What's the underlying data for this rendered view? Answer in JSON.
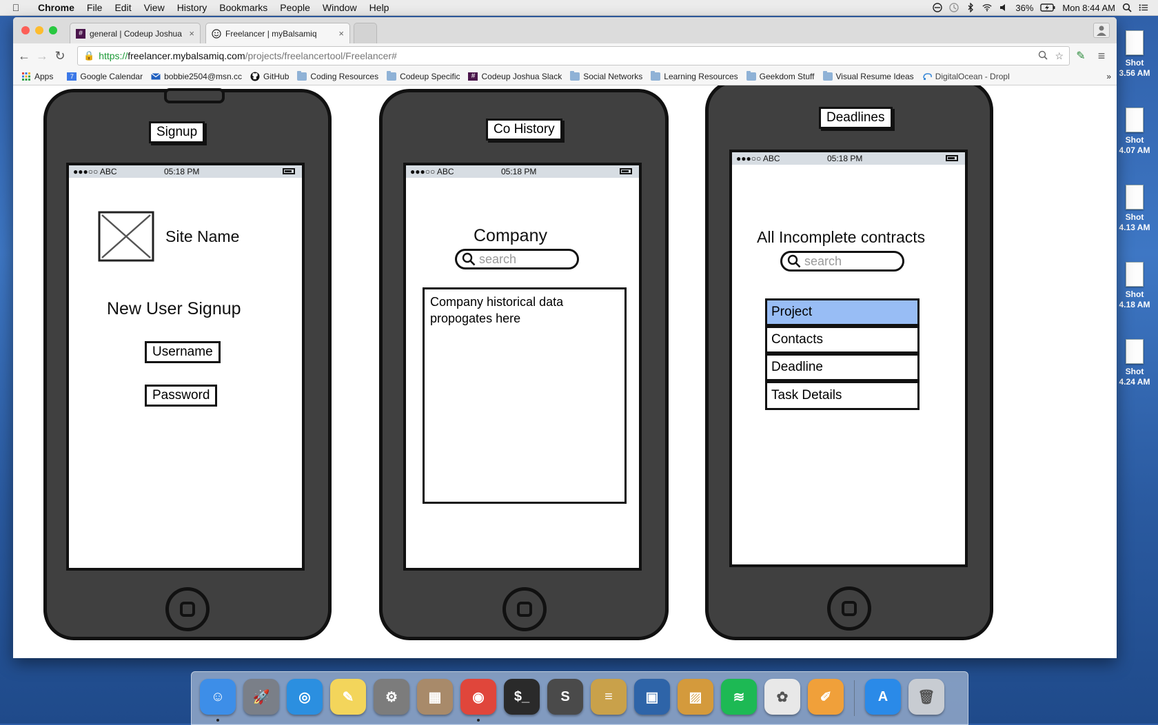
{
  "menubar": {
    "app": "Chrome",
    "items": [
      "File",
      "Edit",
      "View",
      "History",
      "Bookmarks",
      "People",
      "Window",
      "Help"
    ],
    "battery": "36%",
    "clock": "Mon 8:44 AM"
  },
  "desktop": {
    "items": [
      {
        "line1": "Shot",
        "line2": "3.56 AM"
      },
      {
        "line1": "Shot",
        "line2": "4.07 AM"
      },
      {
        "line1": "Shot",
        "line2": "4.13 AM"
      },
      {
        "line1": "Shot",
        "line2": "4.18 AM"
      },
      {
        "line1": "Shot",
        "line2": "4.24 AM"
      }
    ]
  },
  "browser": {
    "tabs": [
      {
        "label": "general | Codeup Joshua S",
        "icon": "slack-hash-icon",
        "active": false
      },
      {
        "label": "Freelancer | myBalsamiq",
        "icon": "smiley-icon",
        "active": true
      }
    ],
    "url": {
      "scheme": "https://",
      "host": "freelancer.mybalsamiq.com",
      "path": "/projects/freelancertool/Freelancer#"
    },
    "bookmarks": [
      {
        "label": "Apps",
        "icon": "apps-grid-icon"
      },
      {
        "label": "Google Calendar",
        "icon": "calendar-icon"
      },
      {
        "label": "bobbie2504@msn.cc",
        "icon": "mail-icon"
      },
      {
        "label": "GitHub",
        "icon": "github-icon"
      },
      {
        "label": "Coding Resources",
        "icon": "folder-icon"
      },
      {
        "label": "Codeup Specific",
        "icon": "folder-icon"
      },
      {
        "label": "Codeup Joshua Slack",
        "icon": "slack-hash-icon"
      },
      {
        "label": "Social Networks",
        "icon": "folder-icon"
      },
      {
        "label": "Learning Resources",
        "icon": "folder-icon"
      },
      {
        "label": "Geekdom Stuff",
        "icon": "folder-icon"
      },
      {
        "label": "Visual Resume Ideas",
        "icon": "folder-icon"
      },
      {
        "label": "DigitalOcean - Dropl",
        "icon": "digitalocean-icon"
      }
    ],
    "overflow": "»"
  },
  "mockups": {
    "status": {
      "carrier": "●●●○○ ABC",
      "time": "05:18 PM"
    },
    "signup": {
      "label": "Signup",
      "site_name": "Site Name",
      "heading": "New User Signup",
      "username": "Username",
      "password": "Password"
    },
    "history": {
      "label": "Co History",
      "heading": "Company",
      "search_placeholder": "search",
      "text": "Company historical data propogates here"
    },
    "deadlines": {
      "label": "Deadlines",
      "heading": "All Incomplete contracts",
      "search_placeholder": "search",
      "list": [
        "Project",
        "Contacts",
        "Deadline",
        "Task Details"
      ],
      "selected_index": 0
    }
  },
  "dock": {
    "apps": [
      {
        "name": "finder",
        "color": "#3d8ee8",
        "glyph": "☺",
        "running": true
      },
      {
        "name": "launchpad",
        "color": "#7a7f88",
        "glyph": "🚀",
        "running": false
      },
      {
        "name": "safari",
        "color": "#2b8fe0",
        "glyph": "◎",
        "running": false
      },
      {
        "name": "notes",
        "color": "#f3d55b",
        "glyph": "✎",
        "running": false
      },
      {
        "name": "system-preferences",
        "color": "#7c7c7c",
        "glyph": "⚙",
        "running": false
      },
      {
        "name": "calculator",
        "color": "#a88a6a",
        "glyph": "▦",
        "running": false
      },
      {
        "name": "chrome",
        "color": "#e0463b",
        "glyph": "◉",
        "running": true
      },
      {
        "name": "terminal",
        "color": "#2a2a2a",
        "glyph": "$_",
        "running": false
      },
      {
        "name": "sublime-text",
        "color": "#4a4a4a",
        "glyph": "S",
        "running": false
      },
      {
        "name": "sequel-pro",
        "color": "#c9a14a",
        "glyph": "≡",
        "running": false
      },
      {
        "name": "virtualbox",
        "color": "#2e64a8",
        "glyph": "▣",
        "running": false
      },
      {
        "name": "preview",
        "color": "#d49a3c",
        "glyph": "▨",
        "running": false
      },
      {
        "name": "spotify",
        "color": "#1db954",
        "glyph": "≋",
        "running": false
      },
      {
        "name": "photos",
        "color": "#e8e8e8",
        "glyph": "✿",
        "running": false
      },
      {
        "name": "pages",
        "color": "#f0a03a",
        "glyph": "✐",
        "running": false
      },
      {
        "name": "app-store",
        "color": "#2a8ae8",
        "glyph": "A",
        "running": false
      },
      {
        "name": "trash",
        "color": "#c8ccd2",
        "glyph": "🗑",
        "running": false
      }
    ]
  }
}
